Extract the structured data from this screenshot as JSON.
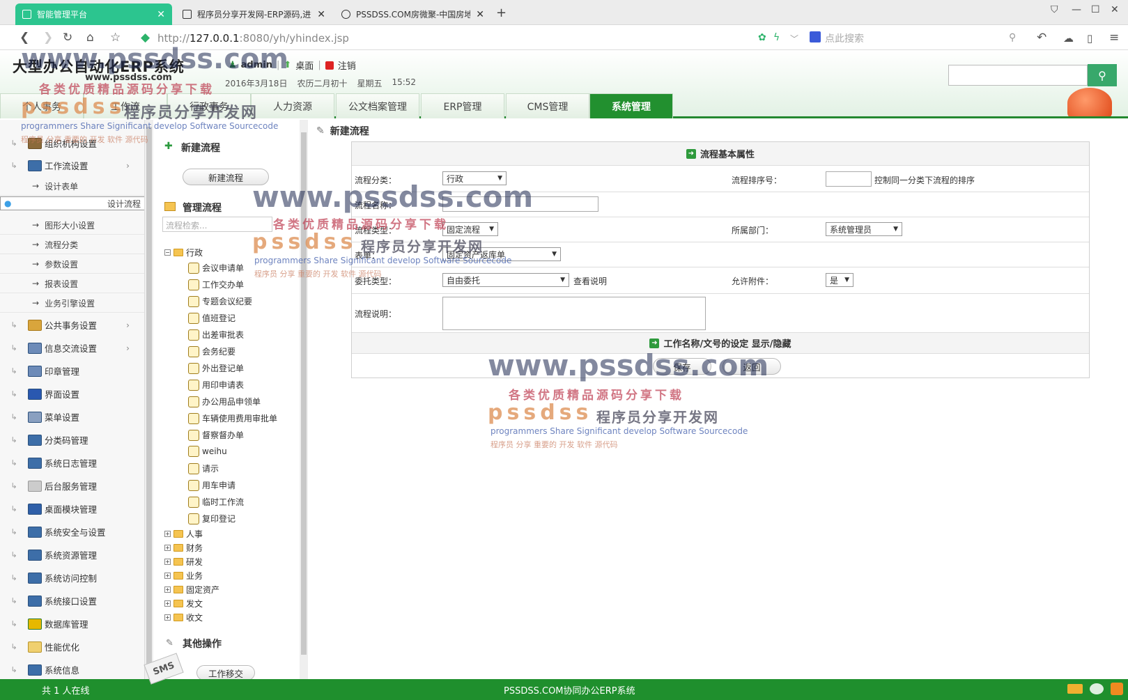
{
  "browser": {
    "tabs": [
      {
        "title": "智能管理平台",
        "active": true
      },
      {
        "title": "程序员分享开发网-ERP源码,进销",
        "active": false
      },
      {
        "title": "PSSDSS.COM房微聚-中国房地产",
        "active": false
      }
    ],
    "url_host": "127.0.0.1",
    "url_prefix": "http://",
    "url_rest": ":8080/yh/yhindex.jsp",
    "search_placeholder": "点此搜索"
  },
  "header": {
    "logo": "大型办公自动化ERP系统",
    "logo_sub": "www.pssdss.com",
    "user": "admin",
    "desktop": "桌面",
    "logout": "注销",
    "date": "2016年3月18日",
    "lunar": "农历二月初十",
    "weekday": "星期五",
    "time": "15:52",
    "search_btn_icon": "search-icon"
  },
  "nav_tabs": [
    {
      "label": "个人事务",
      "active": false
    },
    {
      "label": "工作流",
      "active": false
    },
    {
      "label": "行政事务",
      "active": false
    },
    {
      "label": "人力资源",
      "active": false
    },
    {
      "label": "公文档案管理",
      "active": false
    },
    {
      "label": "ERP管理",
      "active": false
    },
    {
      "label": "CMS管理",
      "active": false
    },
    {
      "label": "系统管理",
      "active": true
    }
  ],
  "sidebar": {
    "items": [
      {
        "label": "组织机构设置",
        "icon": "org-icon",
        "chevron": false
      },
      {
        "label": "工作流设置",
        "icon": "monitor-icon",
        "chevron": true
      }
    ],
    "subitems": [
      {
        "label": "设计表单",
        "selected": false
      },
      {
        "label": "设计流程",
        "selected": true
      },
      {
        "label": "图形大小设置",
        "selected": false
      },
      {
        "label": "流程分类",
        "selected": false
      },
      {
        "label": "参数设置",
        "selected": false
      },
      {
        "label": "报表设置",
        "selected": false
      },
      {
        "label": "业务引擎设置",
        "selected": false
      }
    ],
    "items2": [
      {
        "label": "公共事务设置",
        "chevron": true
      },
      {
        "label": "信息交流设置",
        "chevron": true
      },
      {
        "label": "印章管理",
        "chevron": false
      },
      {
        "label": "界面设置",
        "chevron": false
      },
      {
        "label": "菜单设置",
        "chevron": false
      },
      {
        "label": "分类码管理",
        "chevron": false
      },
      {
        "label": "系统日志管理",
        "chevron": false
      },
      {
        "label": "后台服务管理",
        "chevron": false
      },
      {
        "label": "桌面模块管理",
        "chevron": false
      },
      {
        "label": "系统安全与设置",
        "chevron": false
      },
      {
        "label": "系统资源管理",
        "chevron": false
      },
      {
        "label": "系统访问控制",
        "chevron": false
      },
      {
        "label": "系统接口设置",
        "chevron": false
      },
      {
        "label": "数据库管理",
        "chevron": false
      },
      {
        "label": "性能优化",
        "chevron": false
      },
      {
        "label": "系统信息",
        "chevron": false
      }
    ]
  },
  "tree": {
    "new_section": "新建流程",
    "new_button": "新建流程",
    "manage_section": "管理流程",
    "search_placeholder": "流程检索...",
    "root": "行政",
    "leaves": [
      "会议申请单",
      "工作交办单",
      "专题会议纪要",
      "值班登记",
      "出差审批表",
      "会务纪要",
      "外出登记单",
      "用印申请表",
      "办公用品申领单",
      "车辆使用费用审批单",
      "督察督办单",
      "weihu",
      "请示",
      "用车申请",
      "临时工作流",
      "复印登记"
    ],
    "folders": [
      "人事",
      "财务",
      "研发",
      "业务",
      "固定资产",
      "发文",
      "收文"
    ],
    "other_section": "其他操作",
    "transfer_button": "工作移交"
  },
  "main": {
    "title": "新建流程",
    "form_header": "流程基本属性",
    "category_label": "流程分类：",
    "category_value": "行政",
    "order_label": "流程排序号：",
    "order_hint": "控制同一分类下流程的排序",
    "name_label": "流程名称：",
    "type_label": "流程类型：",
    "type_value": "固定流程",
    "dept_label": "所属部门：",
    "dept_value": "系统管理员",
    "form_label": "表单：",
    "form_value": "固定资产返库单",
    "delegate_label": "委托类型：",
    "delegate_value": "自由委托",
    "delegate_link": "查看说明",
    "attach_label": "允许附件：",
    "attach_value": "是",
    "desc_label": "流程说明：",
    "work_name_header": "工作名称/文号的设定 显示/隐藏",
    "save_button": "保存",
    "back_button": "返回"
  },
  "status": {
    "online": "共 1 人在线",
    "company": "PSSDSS.COM协同办公ERP系统"
  },
  "watermark": {
    "url": "www.pssdss.com",
    "slogan": "各类优质精品源码分享下载",
    "brand": "pssdss",
    "brand_cn": "程序员分享开发网",
    "en": "programmers Share Significant develop Software Sourcecode",
    "cn_small": "程序员  分享  重要的   开发   软件   源代码"
  },
  "colors": {
    "accent": "#22902f",
    "tab_active": "#2cc58f"
  }
}
